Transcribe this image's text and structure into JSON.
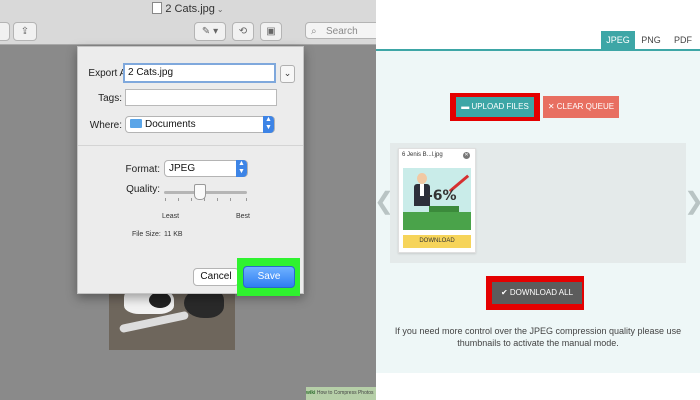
{
  "left": {
    "window_title": "2 Cats.jpg",
    "toolbar": {
      "search_placeholder": "Search"
    },
    "dialog": {
      "export_as_label": "Export As:",
      "export_as_value": "2 Cats.jpg",
      "tags_label": "Tags:",
      "tags_value": "",
      "where_label": "Where:",
      "where_value": "Documents",
      "format_label": "Format:",
      "format_value": "JPEG",
      "quality_label": "Quality:",
      "quality_level": 0.42,
      "least_label": "Least",
      "best_label": "Best",
      "file_size_label": "File Size:",
      "file_size_value": "11 KB",
      "cancel_label": "Cancel",
      "save_label": "Save"
    },
    "highlight_color": "#2ff22f",
    "watermark": {
      "brand": "wiki",
      "text": "How to Compress Photos"
    }
  },
  "right": {
    "tabs": [
      {
        "label": "JPEG",
        "active": true
      },
      {
        "label": "PNG",
        "active": false
      },
      {
        "label": "PDF",
        "active": false
      }
    ],
    "upload_label": "UPLOAD FILES",
    "clear_label": "CLEAR QUEUE",
    "file": {
      "name": "6 Jenis B...l.jpg",
      "percent": "-6%",
      "download_label": "DOWNLOAD"
    },
    "download_all_label": "DOWNLOAD ALL",
    "info_text": "If you need more control over the JPEG compression quality please use thumbnails to activate the manual mode.",
    "colors": {
      "accent": "#3da6a6",
      "clear": "#e86f61",
      "highlight": "#e40000",
      "download": "#f6d45a"
    }
  }
}
